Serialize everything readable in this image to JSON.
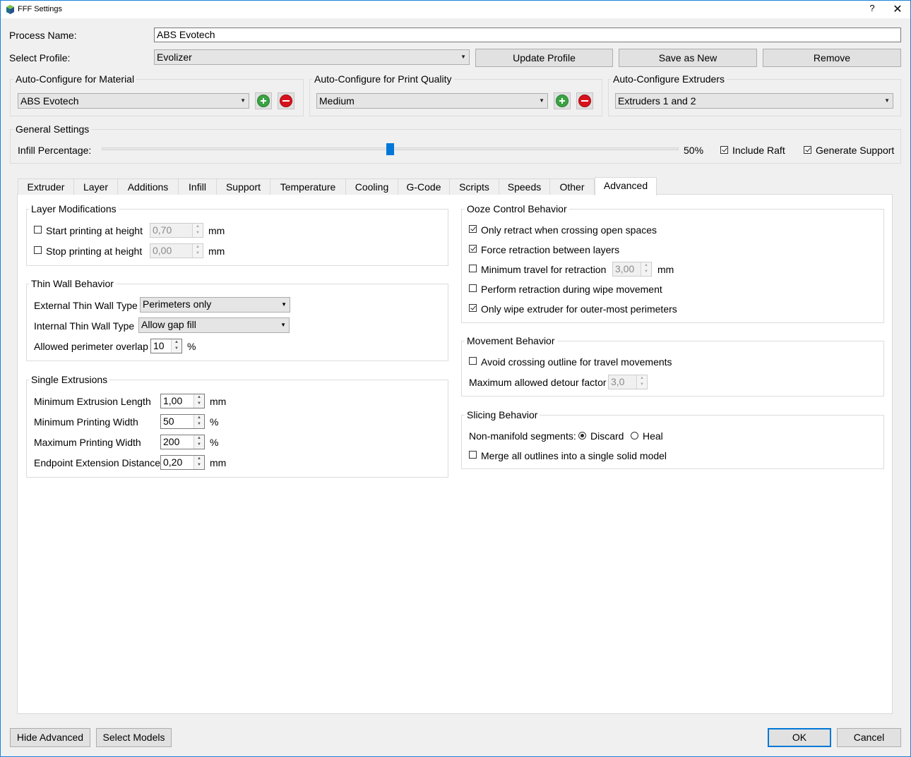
{
  "window": {
    "title": "FFF Settings",
    "help": "?",
    "close": "✕"
  },
  "process": {
    "label": "Process Name:",
    "value": "ABS Evotech"
  },
  "profile": {
    "label": "Select Profile:",
    "value": "Evolizer",
    "update": "Update Profile",
    "save_new": "Save as New",
    "remove": "Remove"
  },
  "auto_material": {
    "title": "Auto-Configure for Material",
    "value": "ABS Evotech"
  },
  "auto_quality": {
    "title": "Auto-Configure for Print Quality",
    "value": "Medium"
  },
  "auto_extruders": {
    "title": "Auto-Configure Extruders",
    "value": "Extruders 1 and 2"
  },
  "general": {
    "title": "General Settings",
    "infill_label": "Infill Percentage:",
    "infill_value": "50%",
    "infill_fraction": 0.5,
    "include_raft": "Include Raft",
    "generate_support": "Generate Support"
  },
  "tabs": [
    "Extruder",
    "Layer",
    "Additions",
    "Infill",
    "Support",
    "Temperature",
    "Cooling",
    "G-Code",
    "Scripts",
    "Speeds",
    "Other",
    "Advanced"
  ],
  "layer_mod": {
    "title": "Layer Modifications",
    "start_label": "Start printing at height",
    "start_value": "0,70",
    "stop_label": "Stop printing at height",
    "stop_value": "0,00",
    "unit": "mm"
  },
  "thin_wall": {
    "title": "Thin Wall Behavior",
    "external_label": "External Thin Wall Type",
    "external_value": "Perimeters only",
    "internal_label": "Internal Thin Wall Type",
    "internal_value": "Allow gap fill",
    "overlap_label": "Allowed perimeter overlap",
    "overlap_value": "10",
    "overlap_unit": "%"
  },
  "single_ext": {
    "title": "Single Extrusions",
    "min_len_label": "Minimum Extrusion Length",
    "min_len_value": "1,00",
    "min_len_unit": "mm",
    "min_width_label": "Minimum Printing Width",
    "min_width_value": "50",
    "min_width_unit": "%",
    "max_width_label": "Maximum Printing Width",
    "max_width_value": "200",
    "max_width_unit": "%",
    "endpoint_label": "Endpoint Extension Distance",
    "endpoint_value": "0,20",
    "endpoint_unit": "mm"
  },
  "ooze": {
    "title": "Ooze Control Behavior",
    "only_retract": "Only retract when crossing open spaces",
    "force_retract": "Force retraction between layers",
    "min_travel": "Minimum travel for retraction",
    "min_travel_value": "3,00",
    "min_travel_unit": "mm",
    "wipe_retract": "Perform retraction during wipe movement",
    "only_wipe": "Only wipe extruder for outer-most perimeters"
  },
  "movement": {
    "title": "Movement Behavior",
    "avoid": "Avoid crossing outline for travel movements",
    "detour_label": "Maximum allowed detour factor",
    "detour_value": "3,0"
  },
  "slicing": {
    "title": "Slicing Behavior",
    "nonmanifold_label": "Non-manifold segments:",
    "discard": "Discard",
    "heal": "Heal",
    "merge": "Merge all outlines into a single solid model"
  },
  "footer": {
    "hide_advanced": "Hide Advanced",
    "select_models": "Select Models",
    "ok": "OK",
    "cancel": "Cancel"
  }
}
